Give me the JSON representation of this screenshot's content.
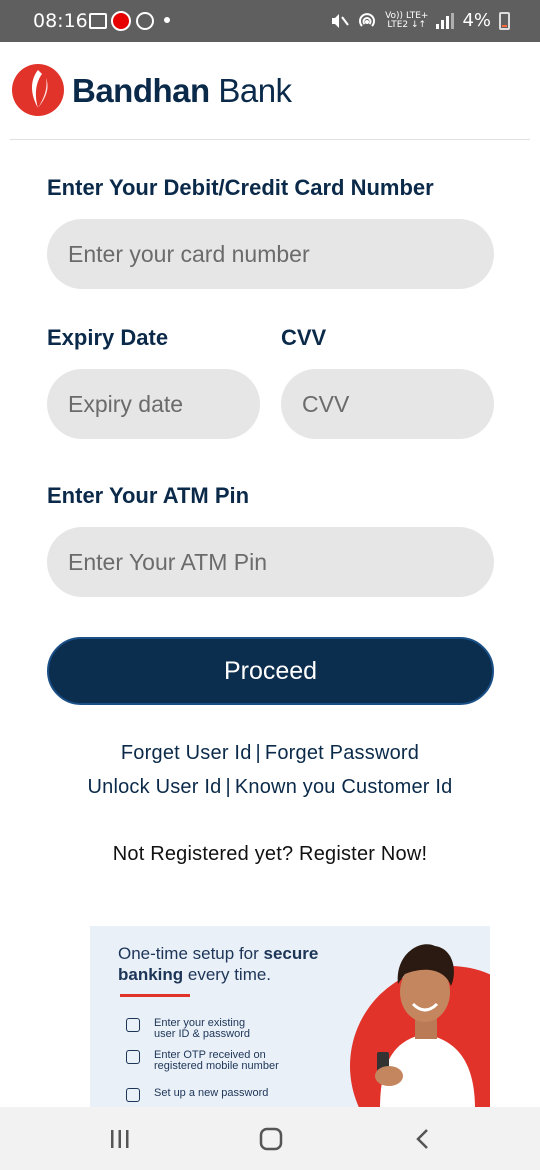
{
  "status_bar": {
    "time": "08:16",
    "network": "LTE+",
    "network_sub": "LTE2",
    "volte": "Vo))",
    "battery": "4%",
    "icons": [
      "gallery-icon",
      "vodafone-icon",
      "at-icon",
      "notification-dot",
      "mute-icon",
      "hotspot-icon",
      "signal-icon",
      "battery-icon"
    ]
  },
  "header": {
    "brand_bold": "Bandhan",
    "brand_regular": " Bank"
  },
  "form": {
    "card_label": "Enter Your Debit/Credit Card Number",
    "card_placeholder": "Enter your card number",
    "expiry_label": "Expiry Date",
    "expiry_placeholder": "Expiry date",
    "cvv_label": "CVV",
    "cvv_placeholder": "CVV",
    "pin_label": "Enter Your ATM Pin",
    "pin_placeholder": "Enter Your ATM Pin",
    "proceed_label": "Proceed"
  },
  "links": {
    "forget_user_id": "Forget User Id",
    "forget_password": "Forget Password",
    "unlock_user_id": "Unlock User Id",
    "known_customer_id": "Known you Customer Id",
    "separator": "|",
    "not_registered": "Not Registered yet? Register Now!"
  },
  "banner": {
    "title_part1": "One-time setup for ",
    "title_bold1": "secure",
    "title_bold2": "banking",
    "title_part2": " every time.",
    "steps": [
      {
        "line1": "Enter your existing",
        "line2": "user ID & password"
      },
      {
        "line1": "Enter OTP received on",
        "line2": "registered mobile number"
      },
      {
        "line1": "Set up a new password",
        "line2": ""
      }
    ]
  },
  "colors": {
    "brand_navy": "#0b2d4e",
    "brand_red": "#e2332a",
    "field_bg": "#e6e6e6",
    "status_bar": "#5f5f5f"
  }
}
